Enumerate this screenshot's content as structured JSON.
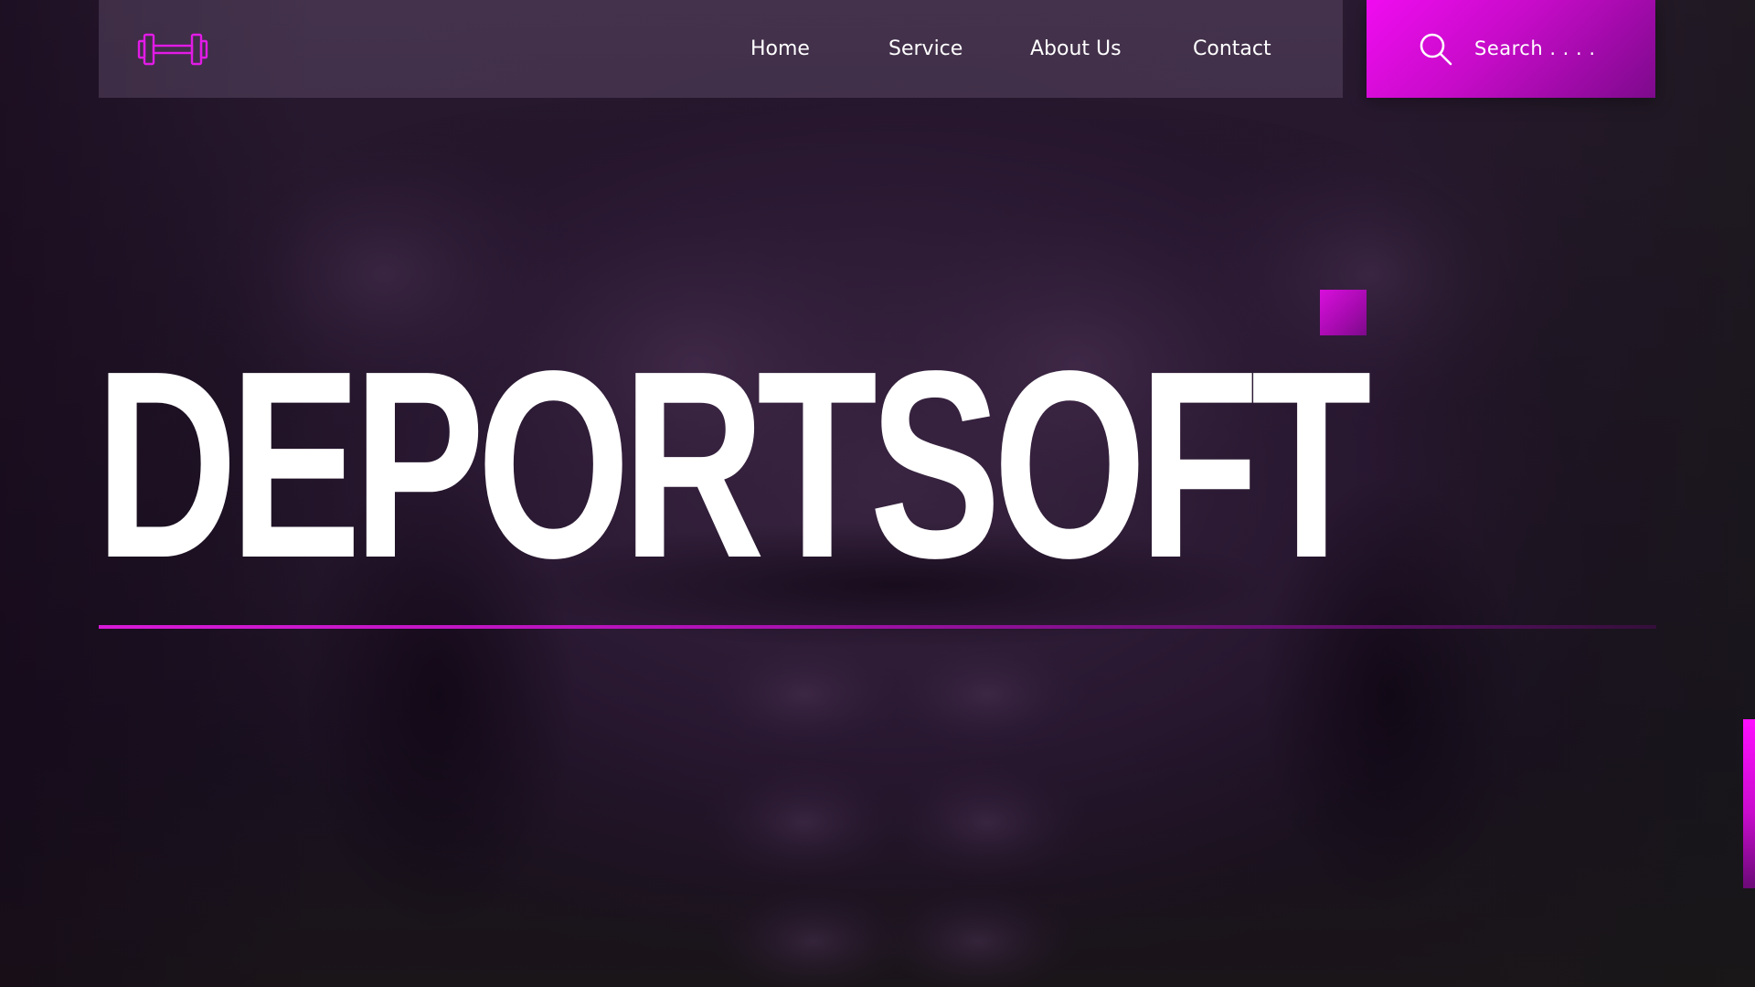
{
  "nav": {
    "logo_icon": "dumbbell-icon",
    "links": [
      "Home",
      "Service",
      "About Us",
      "Contact"
    ]
  },
  "search": {
    "icon": "search-icon",
    "placeholder": "Search . . . ."
  },
  "hero": {
    "title": "DEPORTSOFT",
    "background": "muscular-torso-photo"
  },
  "colors": {
    "accent": "#e00be6",
    "accent_dark": "#7d0a8c",
    "text": "#ffffff",
    "overlay": "#2a1a31"
  }
}
